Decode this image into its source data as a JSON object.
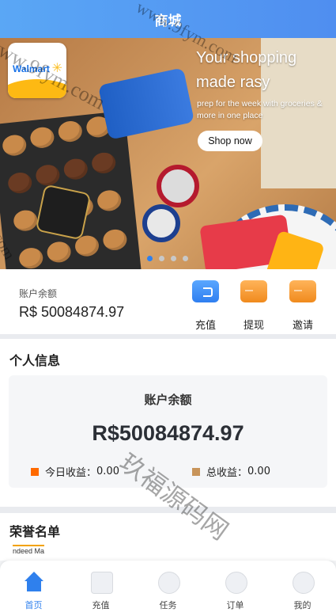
{
  "header": {
    "title": "商城"
  },
  "banner": {
    "brand": "Walmart",
    "headline_line1": "Your shopping",
    "headline_line2": "made rasy",
    "subline": "prep for the week with groceries & more in one place",
    "cta": "Shop now",
    "dots": 4,
    "active_dot": 0
  },
  "balance": {
    "label": "账户余额",
    "value": "R$ 50084874.97",
    "actions": [
      {
        "label": "充值",
        "icon": "wallet-icon",
        "color": "#2f7ff0"
      },
      {
        "label": "提现",
        "icon": "card-icon",
        "color": "#f08a1d"
      },
      {
        "label": "邀请",
        "icon": "card-icon",
        "color": "#f08a1d"
      }
    ]
  },
  "personal": {
    "title": "个人信息",
    "card_label": "账户余额",
    "card_value": "R$50084874.97",
    "today_label": "今日收益：",
    "today_value": "0.00",
    "total_label": "总收益：",
    "total_value": "0.00",
    "today_color": "#ff6a00",
    "total_color": "#c8945a"
  },
  "honor": {
    "title": "荣誉名单",
    "first_logo": "ndeed Ma"
  },
  "tabbar": {
    "items": [
      {
        "label": "首页",
        "icon": "home-icon"
      },
      {
        "label": "充值",
        "icon": "recharge-icon"
      },
      {
        "label": "任务",
        "icon": "task-icon"
      },
      {
        "label": "订单",
        "icon": "order-icon"
      },
      {
        "label": "我的",
        "icon": "profile-icon"
      }
    ],
    "active": 0
  },
  "watermarks": [
    "www.9fym.com",
    "www.9fym.com",
    "9fym.com",
    "玖福源码网"
  ]
}
